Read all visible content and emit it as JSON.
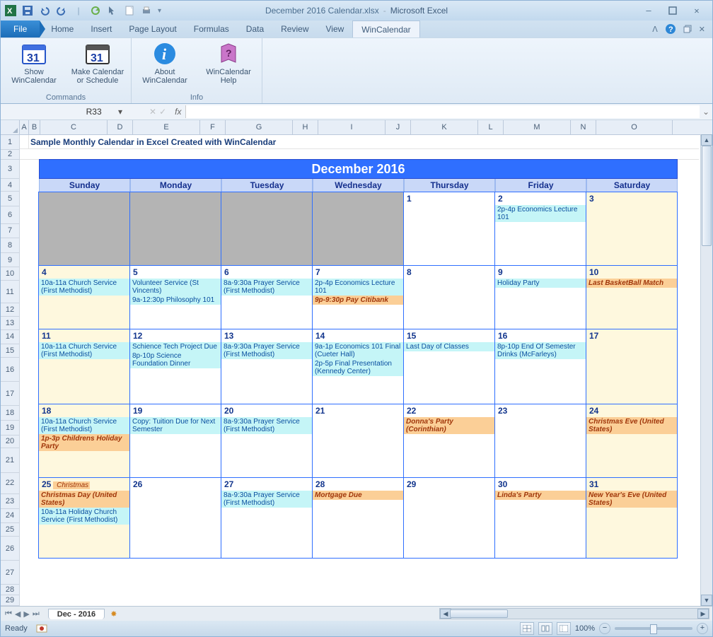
{
  "app": {
    "filename": "December 2016 Calendar.xlsx",
    "appname": "Microsoft Excel"
  },
  "ribbon_tabs": [
    "File",
    "Home",
    "Insert",
    "Page Layout",
    "Formulas",
    "Data",
    "Review",
    "View",
    "WinCalendar"
  ],
  "ribbon": {
    "cmd_group": "Commands",
    "info_group": "Info",
    "btn_show": "Show WinCalendar",
    "btn_make": "Make Calendar or Schedule",
    "btn_about": "About WinCalendar",
    "btn_help": "WinCalendar Help"
  },
  "namebox": "R33",
  "fx_label": "fx",
  "columns": [
    "A",
    "B",
    "C",
    "D",
    "E",
    "F",
    "G",
    "H",
    "I",
    "J",
    "K",
    "L",
    "M",
    "N",
    "O"
  ],
  "row_nums": [
    "1",
    "2",
    "3",
    "4",
    "5",
    "6",
    "7",
    "8",
    "9",
    "10",
    "11",
    "12",
    "13",
    "14",
    "15",
    "16",
    "17",
    "18",
    "19",
    "20",
    "21",
    "22",
    "23",
    "24",
    "25",
    "26",
    "27",
    "28",
    "29"
  ],
  "sheet_title": "Sample Monthly Calendar in Excel Created with WinCalendar",
  "cal_title": "December 2016",
  "day_headers": [
    "Sunday",
    "Monday",
    "Tuesday",
    "Wednesday",
    "Thursday",
    "Friday",
    "Saturday"
  ],
  "weeks": [
    [
      {
        "date": "",
        "grey": true,
        "events": []
      },
      {
        "date": "",
        "grey": true,
        "events": []
      },
      {
        "date": "",
        "grey": true,
        "events": []
      },
      {
        "date": "",
        "grey": true,
        "events": []
      },
      {
        "date": "1",
        "events": []
      },
      {
        "date": "2",
        "events": [
          {
            "t": "2p-4p Economics Lecture 101",
            "k": "cyan"
          }
        ]
      },
      {
        "date": "3",
        "fade": true,
        "events": []
      }
    ],
    [
      {
        "date": "4",
        "fade": true,
        "events": [
          {
            "t": "10a-11a Church Service (First Methodist)",
            "k": "cyan"
          }
        ]
      },
      {
        "date": "5",
        "events": [
          {
            "t": "Volunteer Service (St Vincents)",
            "k": "cyan"
          },
          {
            "t": "9a-12:30p Philosophy 101",
            "k": "cyan"
          }
        ]
      },
      {
        "date": "6",
        "events": [
          {
            "t": "8a-9:30a Prayer Service (First Methodist)",
            "k": "cyan"
          }
        ]
      },
      {
        "date": "7",
        "events": [
          {
            "t": "2p-4p Economics Lecture 101",
            "k": "cyan"
          },
          {
            "t": "9p-9:30p Pay Citibank",
            "k": "orange"
          }
        ]
      },
      {
        "date": "8",
        "events": []
      },
      {
        "date": "9",
        "events": [
          {
            "t": "Holiday Party",
            "k": "cyan"
          }
        ]
      },
      {
        "date": "10",
        "fade": true,
        "events": [
          {
            "t": "Last BasketBall Match",
            "k": "orange"
          }
        ]
      }
    ],
    [
      {
        "date": "11",
        "fade": true,
        "events": [
          {
            "t": "10a-11a Church Service (First Methodist)",
            "k": "cyan"
          }
        ]
      },
      {
        "date": "12",
        "events": [
          {
            "t": "Schience Tech Project Due",
            "k": "cyan"
          },
          {
            "t": "8p-10p Science Foundation Dinner",
            "k": "cyan"
          }
        ]
      },
      {
        "date": "13",
        "events": [
          {
            "t": "8a-9:30a Prayer Service (First Methodist)",
            "k": "cyan"
          }
        ]
      },
      {
        "date": "14",
        "events": [
          {
            "t": "9a-1p Economics 101 Final (Cueter Hall)",
            "k": "cyan"
          },
          {
            "t": "2p-5p Final Presentation (Kennedy Center)",
            "k": "cyan"
          }
        ]
      },
      {
        "date": "15",
        "events": [
          {
            "t": "Last Day of Classes",
            "k": "cyan"
          }
        ]
      },
      {
        "date": "16",
        "events": [
          {
            "t": "8p-10p End Of Semester Drinks (McFarleys)",
            "k": "cyan"
          }
        ]
      },
      {
        "date": "17",
        "fade": true,
        "events": []
      }
    ],
    [
      {
        "date": "18",
        "fade": true,
        "events": [
          {
            "t": "10a-11a Church Service (First Methodist)",
            "k": "cyan"
          },
          {
            "t": "1p-3p Childrens Holiday Party",
            "k": "orange"
          }
        ]
      },
      {
        "date": "19",
        "events": [
          {
            "t": "Copy: Tuition Due for Next Semester",
            "k": "cyan"
          }
        ]
      },
      {
        "date": "20",
        "events": [
          {
            "t": "8a-9:30a Prayer Service (First Methodist)",
            "k": "cyan"
          }
        ]
      },
      {
        "date": "21",
        "events": []
      },
      {
        "date": "22",
        "events": [
          {
            "t": "Donna's Party (Corinthian)",
            "k": "orange"
          }
        ]
      },
      {
        "date": "23",
        "events": []
      },
      {
        "date": "24",
        "fade": true,
        "events": [
          {
            "t": "Christmas Eve (United States)",
            "k": "orange"
          }
        ]
      }
    ],
    [
      {
        "date": "25",
        "fade": true,
        "date_suffix": "Christmas",
        "events": [
          {
            "t": "Christmas Day (United States)",
            "k": "orange"
          },
          {
            "t": "10a-11a Holiday Church Service (First Methodist)",
            "k": "cyan"
          }
        ]
      },
      {
        "date": "26",
        "events": []
      },
      {
        "date": "27",
        "events": [
          {
            "t": "8a-9:30a Prayer Service (First Methodist)",
            "k": "cyan"
          }
        ]
      },
      {
        "date": "28",
        "events": [
          {
            "t": "Mortgage Due",
            "k": "orange"
          }
        ]
      },
      {
        "date": "29",
        "events": []
      },
      {
        "date": "30",
        "events": [
          {
            "t": "Linda's Party",
            "k": "orange"
          }
        ]
      },
      {
        "date": "31",
        "fade": true,
        "events": [
          {
            "t": "New Year's Eve (United States)",
            "k": "orange"
          }
        ]
      }
    ]
  ],
  "sheet_tab": "Dec - 2016",
  "status": "Ready",
  "zoom": "100%"
}
